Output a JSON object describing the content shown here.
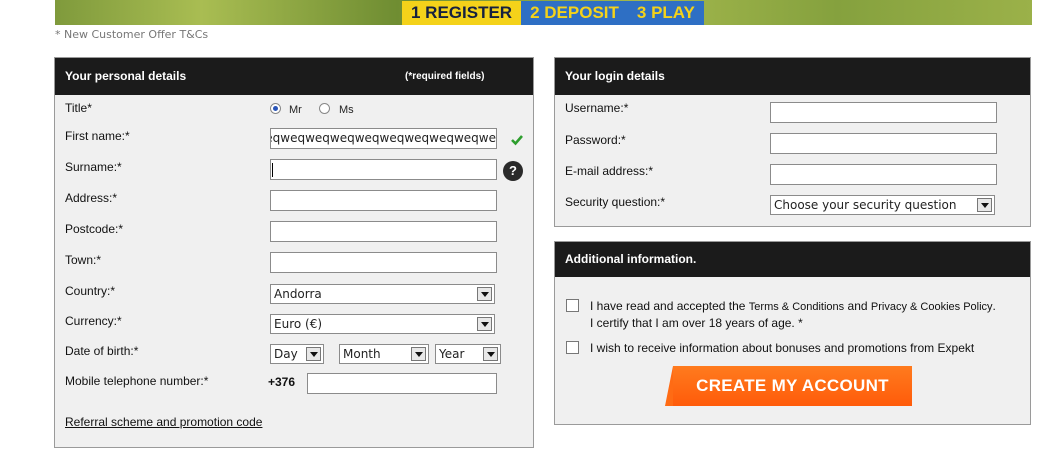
{
  "banner": {
    "steps": [
      {
        "label": "1 REGISTER"
      },
      {
        "label": "2 DEPOSIT"
      },
      {
        "label": "3 PLAY"
      }
    ],
    "offer_note": "* New Customer Offer T&Cs"
  },
  "personal": {
    "heading": "Your personal details",
    "required_note": "(*required fields)",
    "title_label": "Title*",
    "title_options": [
      "Mr",
      "Ms"
    ],
    "title_selected": "Mr",
    "first_name_label": "First name:*",
    "first_name_value": "eqweqweqweqweqweqweqweqweqweqwe",
    "surname_label": "Surname:*",
    "surname_value": "",
    "address_label": "Address:*",
    "postcode_label": "Postcode:*",
    "town_label": "Town:*",
    "country_label": "Country:*",
    "country_value": "Andorra",
    "currency_label": "Currency:*",
    "currency_value": "Euro (€)",
    "dob_label": "Date of birth:*",
    "dob_day": "Day",
    "dob_month": "Month",
    "dob_year": "Year",
    "mobile_label": "Mobile telephone number:*",
    "mobile_prefix": "+376",
    "referral_link": "Referral scheme and promotion code"
  },
  "login": {
    "heading": "Your login details",
    "username_label": "Username:*",
    "password_label": "Password:*",
    "email_label": "E-mail address:*",
    "security_label": "Security question:*",
    "security_value": "Choose your security question"
  },
  "additional": {
    "heading": "Additional information.",
    "terms_text_1": "I have read and accepted the",
    "terms_link": "Terms & Conditions",
    "terms_and": "and",
    "privacy_link": "Privacy & Cookies Policy",
    "terms_text_2": ". I certify that I am over 18 years of age. *",
    "bonus_text": "I wish to receive information about bonuses and promotions from Expekt",
    "create_button": "CREATE MY ACCOUNT"
  },
  "icons": {
    "valid": "check-icon",
    "help": "question-icon"
  },
  "colors": {
    "accent_orange": "#ff6b14",
    "header_dark": "#1b1b1b",
    "step_yellow": "#f4d21a",
    "step_blue": "#2e6fc4",
    "valid_green": "#2e9e2e"
  }
}
